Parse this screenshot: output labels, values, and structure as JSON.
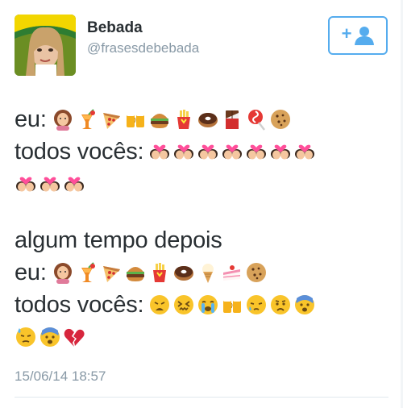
{
  "tweet": {
    "author_name": "Bebada",
    "author_handle": "@frasesdebebada",
    "timestamp": "15/06/14 18:57",
    "follow_icon": "add-user-icon",
    "lines": [
      {
        "label": "eu:",
        "emojis": [
          "woman",
          "tropical-drink",
          "pizza",
          "beers",
          "hamburger",
          "fries",
          "donut",
          "chocolate-bar",
          "lollipop",
          "cookie"
        ]
      },
      {
        "label": "todos vocês:",
        "emojis": [
          "couple-kiss",
          "couple-kiss",
          "couple-kiss",
          "couple-kiss",
          "couple-kiss",
          "couple-kiss",
          "couple-kiss"
        ]
      },
      {
        "label": "",
        "emojis": [
          "couple-kiss",
          "couple-kiss",
          "couple-kiss"
        ]
      },
      {
        "gap": true
      },
      {
        "label": "algum tempo depois",
        "emojis": []
      },
      {
        "label": "eu:",
        "emojis": [
          "woman",
          "tropical-drink",
          "pizza",
          "hamburger",
          "fries",
          "donut",
          "ice-cream",
          "cake",
          "cookie"
        ]
      },
      {
        "label": "todos vocês:",
        "emojis": [
          "weary-face",
          "confounded-face",
          "crying-face",
          "beers",
          "sleepy-face",
          "disappointed-face",
          "fearful-face"
        ]
      },
      {
        "label": "",
        "emojis": [
          "sweat-face",
          "fearful-face",
          "broken-heart"
        ]
      }
    ]
  },
  "colors": {
    "text": "#292f33",
    "muted": "#8899a6",
    "accent": "#55acee",
    "divider": "#e1e8ed"
  }
}
